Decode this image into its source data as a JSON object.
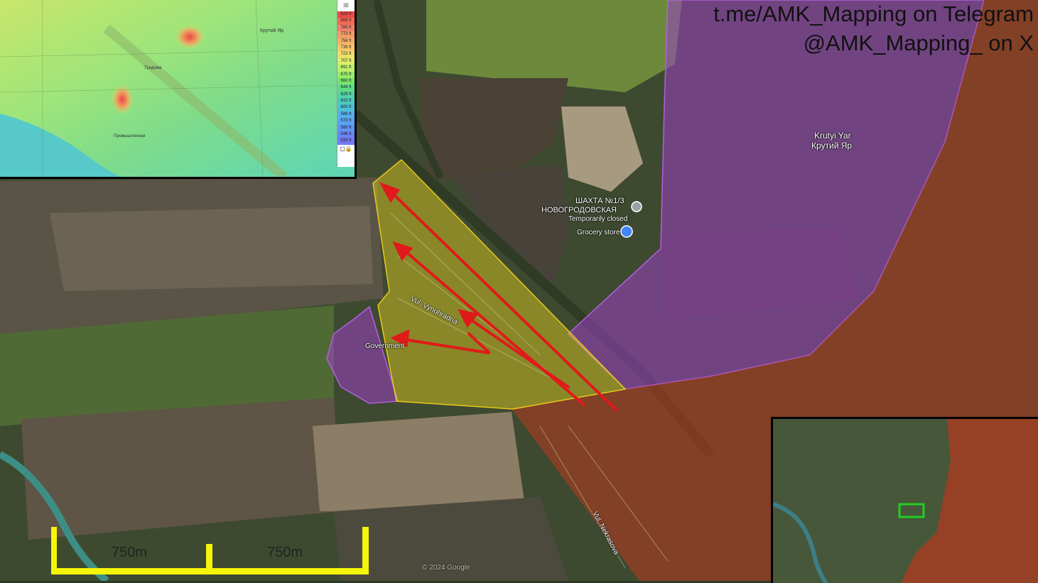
{
  "credits": {
    "telegram": "t.me/AMK_Mapping on Telegram",
    "x": "@AMK_Mapping_ on X"
  },
  "map_labels": {
    "krutyi_yar_en": "Krutyi Yar",
    "krutyi_yar_ru": "Крутий Яр",
    "shakhta_1": "ШАХТА №1/3",
    "shakhta_2": "НОВОГРОДОВСКАЯ",
    "temporarily_closed": "Temporarily closed",
    "grocery": "Grocery store",
    "vynohradna": "Vul. Vynohradna",
    "government": "Government",
    "vul_nekrasova": "Vul. Nekrasova",
    "google_watermark": "© 2024 Google"
  },
  "scale_bar": {
    "left_label": "750m",
    "right_label": "750m",
    "color": "#f5f50a"
  },
  "colors": {
    "russian_control": "#b03a1f",
    "contested": "#9b3fc4",
    "advance_zone": "#e6d21e",
    "arrow": "#e01a1a",
    "inset_highlight": "#1fcf1f"
  },
  "elevation_legend": {
    "values": [
      "823 ft",
      "806 ft",
      "789 ft",
      "773 ft",
      "756 ft",
      "739 ft",
      "723 ft",
      "707 ft",
      "691 ft",
      "675 ft",
      "660 ft",
      "644 ft",
      "629 ft",
      "615 ft",
      "600 ft",
      "586 ft",
      "573 ft",
      "560 ft",
      "546 ft",
      "533 ft"
    ],
    "colors": [
      "#e84a4a",
      "#ee6a55",
      "#f0806a",
      "#f49c6a",
      "#f6b26a",
      "#f6c86a",
      "#efdf6a",
      "#dfee6a",
      "#bdf06a",
      "#99ec6a",
      "#76e56e",
      "#5fdc86",
      "#55d3a4",
      "#4fcabe",
      "#4ec0d6",
      "#54b2ea",
      "#5aa3f2",
      "#6194f4",
      "#6b86f4",
      "#7479f2"
    ]
  },
  "elevation_inset_labels": {
    "krutyi_yar": "Крутий Яр",
    "village": "Тридома",
    "road": "Промышленная"
  }
}
